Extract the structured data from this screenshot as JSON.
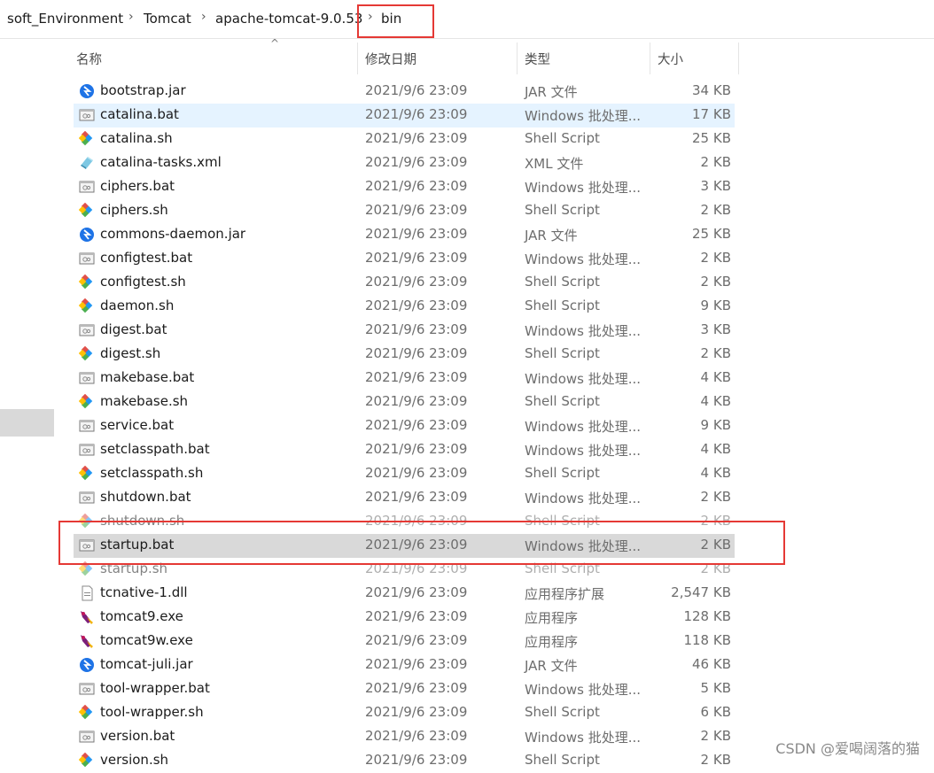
{
  "breadcrumb": {
    "items": [
      "soft_Environment",
      "Tomcat",
      "apache-tomcat-9.0.53",
      "bin"
    ]
  },
  "columns": {
    "name": "名称",
    "date": "修改日期",
    "type": "类型",
    "size": "大小"
  },
  "files": [
    {
      "name": "bootstrap.jar",
      "date": "2021/9/6 23:09",
      "type": "JAR 文件",
      "size": "34 KB",
      "icon": "jar-icon"
    },
    {
      "name": "catalina.bat",
      "date": "2021/9/6 23:09",
      "type": "Windows 批处理...",
      "size": "17 KB",
      "icon": "bat-icon"
    },
    {
      "name": "catalina.sh",
      "date": "2021/9/6 23:09",
      "type": "Shell Script",
      "size": "25 KB",
      "icon": "sh-icon"
    },
    {
      "name": "catalina-tasks.xml",
      "date": "2021/9/6 23:09",
      "type": "XML 文件",
      "size": "2 KB",
      "icon": "xml-icon"
    },
    {
      "name": "ciphers.bat",
      "date": "2021/9/6 23:09",
      "type": "Windows 批处理...",
      "size": "3 KB",
      "icon": "bat-icon"
    },
    {
      "name": "ciphers.sh",
      "date": "2021/9/6 23:09",
      "type": "Shell Script",
      "size": "2 KB",
      "icon": "sh-icon"
    },
    {
      "name": "commons-daemon.jar",
      "date": "2021/9/6 23:09",
      "type": "JAR 文件",
      "size": "25 KB",
      "icon": "jar-icon"
    },
    {
      "name": "configtest.bat",
      "date": "2021/9/6 23:09",
      "type": "Windows 批处理...",
      "size": "2 KB",
      "icon": "bat-icon"
    },
    {
      "name": "configtest.sh",
      "date": "2021/9/6 23:09",
      "type": "Shell Script",
      "size": "2 KB",
      "icon": "sh-icon"
    },
    {
      "name": "daemon.sh",
      "date": "2021/9/6 23:09",
      "type": "Shell Script",
      "size": "9 KB",
      "icon": "sh-icon"
    },
    {
      "name": "digest.bat",
      "date": "2021/9/6 23:09",
      "type": "Windows 批处理...",
      "size": "3 KB",
      "icon": "bat-icon"
    },
    {
      "name": "digest.sh",
      "date": "2021/9/6 23:09",
      "type": "Shell Script",
      "size": "2 KB",
      "icon": "sh-icon"
    },
    {
      "name": "makebase.bat",
      "date": "2021/9/6 23:09",
      "type": "Windows 批处理...",
      "size": "4 KB",
      "icon": "bat-icon"
    },
    {
      "name": "makebase.sh",
      "date": "2021/9/6 23:09",
      "type": "Shell Script",
      "size": "4 KB",
      "icon": "sh-icon"
    },
    {
      "name": "service.bat",
      "date": "2021/9/6 23:09",
      "type": "Windows 批处理...",
      "size": "9 KB",
      "icon": "bat-icon"
    },
    {
      "name": "setclasspath.bat",
      "date": "2021/9/6 23:09",
      "type": "Windows 批处理...",
      "size": "4 KB",
      "icon": "bat-icon"
    },
    {
      "name": "setclasspath.sh",
      "date": "2021/9/6 23:09",
      "type": "Shell Script",
      "size": "4 KB",
      "icon": "sh-icon"
    },
    {
      "name": "shutdown.bat",
      "date": "2021/9/6 23:09",
      "type": "Windows 批处理...",
      "size": "2 KB",
      "icon": "bat-icon"
    },
    {
      "name": "shutdown.sh",
      "date": "2021/9/6 23:09",
      "type": "Shell Script",
      "size": "2 KB",
      "icon": "sh-icon"
    },
    {
      "name": "startup.bat",
      "date": "2021/9/6 23:09",
      "type": "Windows 批处理...",
      "size": "2 KB",
      "icon": "bat-icon"
    },
    {
      "name": "startup.sh",
      "date": "2021/9/6 23:09",
      "type": "Shell Script",
      "size": "2 KB",
      "icon": "sh-icon"
    },
    {
      "name": "tcnative-1.dll",
      "date": "2021/9/6 23:09",
      "type": "应用程序扩展",
      "size": "2,547 KB",
      "icon": "dll-icon"
    },
    {
      "name": "tomcat9.exe",
      "date": "2021/9/6 23:09",
      "type": "应用程序",
      "size": "128 KB",
      "icon": "tomcat-exe-icon"
    },
    {
      "name": "tomcat9w.exe",
      "date": "2021/9/6 23:09",
      "type": "应用程序",
      "size": "118 KB",
      "icon": "tomcat-exe-icon"
    },
    {
      "name": "tomcat-juli.jar",
      "date": "2021/9/6 23:09",
      "type": "JAR 文件",
      "size": "46 KB",
      "icon": "jar-icon"
    },
    {
      "name": "tool-wrapper.bat",
      "date": "2021/9/6 23:09",
      "type": "Windows 批处理...",
      "size": "5 KB",
      "icon": "bat-icon"
    },
    {
      "name": "tool-wrapper.sh",
      "date": "2021/9/6 23:09",
      "type": "Shell Script",
      "size": "6 KB",
      "icon": "sh-icon"
    },
    {
      "name": "version.bat",
      "date": "2021/9/6 23:09",
      "type": "Windows 批处理...",
      "size": "2 KB",
      "icon": "bat-icon"
    },
    {
      "name": "version.sh",
      "date": "2021/9/6 23:09",
      "type": "Shell Script",
      "size": "2 KB",
      "icon": "sh-icon"
    }
  ],
  "hover_row": 1,
  "selected_row": 19,
  "faded_rows": [
    18,
    20
  ],
  "watermark": "CSDN @爱喝阔落的猫",
  "colors": {
    "highlight_box": "#e53935",
    "hover_row": "#cce8ff",
    "selected_row": "#d9d9d9",
    "jar": "#1e73e6",
    "sh_a": "#e0504a",
    "sh_b": "#4caf50",
    "sh_c": "#2196f3",
    "sh_d": "#ffc107"
  }
}
